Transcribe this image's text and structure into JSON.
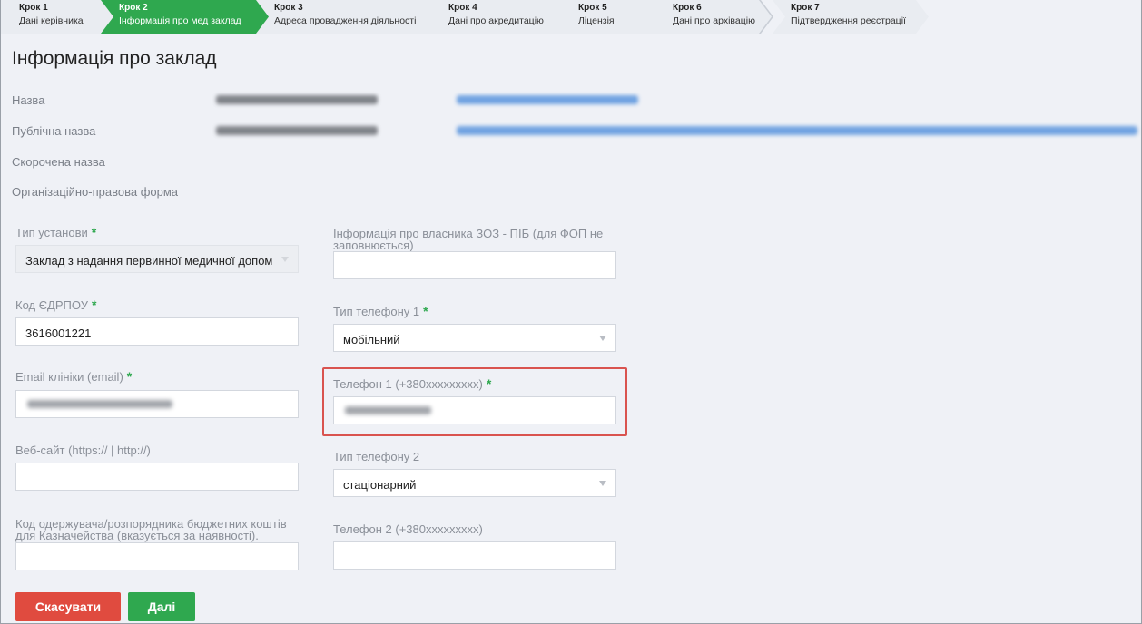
{
  "stepper": [
    {
      "num": "Крок 1",
      "label": "Дані керівника",
      "active": false
    },
    {
      "num": "Крок 2",
      "label": "Інформація про мед заклад",
      "active": true
    },
    {
      "num": "Крок 3",
      "label": "Адреса провадження діяльності",
      "active": false
    },
    {
      "num": "Крок 4",
      "label": "Дані про акредитацію",
      "active": false
    },
    {
      "num": "Крок 5",
      "label": "Ліцензія",
      "active": false
    },
    {
      "num": "Крок 6",
      "label": "Дані про архівацію",
      "active": false
    },
    {
      "num": "Крок 7",
      "label": "Підтвердження реєстрації",
      "active": false
    }
  ],
  "page_title": "Інформація про заклад",
  "info": {
    "name_label": "Назва",
    "public_name_label": "Публічна назва",
    "short_name_label": "Скорочена назва",
    "legal_form_label": "Організаційно-правова форма"
  },
  "form": {
    "institution_type": {
      "label": "Тип установи",
      "value": "Заклад з надання первинної медичної допом"
    },
    "edrpou": {
      "label": "Код ЄДРПОУ",
      "value": "3616001221"
    },
    "email": {
      "label": "Email клініки (email)"
    },
    "website": {
      "label": "Веб-сайт (https:// | http://)",
      "value": ""
    },
    "treasury_code": {
      "label": "Код одержувача/розпорядника бюджетних коштів для Казначейства (вказується за наявності).",
      "value": ""
    },
    "owner_info": {
      "label": "Інформація про власника ЗОЗ - ПІБ (для ФОП не заповнюється)",
      "value": ""
    },
    "phone_type_1": {
      "label": "Тип телефону 1",
      "value": "мобільний"
    },
    "phone_1": {
      "label": "Телефон 1 (+380xxxxxxxxx)"
    },
    "phone_type_2": {
      "label": "Тип телефону 2",
      "value": "стаціонарний"
    },
    "phone_2": {
      "label": "Телефон 2 (+380xxxxxxxxx)",
      "value": ""
    }
  },
  "buttons": {
    "cancel": "Скасувати",
    "next": "Далі"
  },
  "colors": {
    "accent_green": "#2fa84f",
    "cancel_red": "#e04b3f",
    "highlight_red": "#d9534f"
  }
}
